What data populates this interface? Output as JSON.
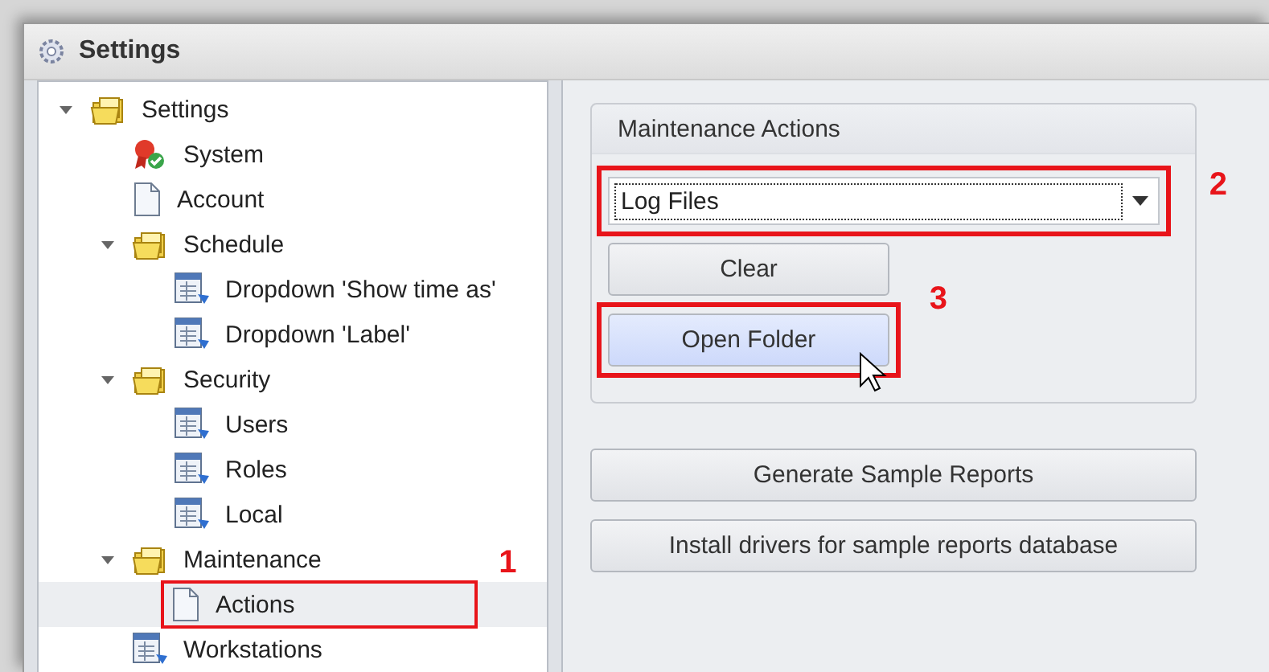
{
  "window": {
    "title": "Settings"
  },
  "tree": [
    {
      "label": "Settings",
      "kind": "folder",
      "expanded": true,
      "selected": false,
      "children": [
        {
          "label": "System",
          "kind": "system",
          "selected": false
        },
        {
          "label": "Account",
          "kind": "page",
          "selected": false
        },
        {
          "label": "Schedule",
          "kind": "folder",
          "expanded": true,
          "selected": false,
          "children": [
            {
              "label": "Dropdown 'Show time as'",
              "kind": "list",
              "selected": false
            },
            {
              "label": "Dropdown 'Label'",
              "kind": "list",
              "selected": false
            }
          ]
        },
        {
          "label": "Security",
          "kind": "folder",
          "expanded": true,
          "selected": false,
          "children": [
            {
              "label": "Users",
              "kind": "list",
              "selected": false
            },
            {
              "label": "Roles",
              "kind": "list",
              "selected": false
            },
            {
              "label": "Local",
              "kind": "list",
              "selected": false
            }
          ]
        },
        {
          "label": "Maintenance",
          "kind": "folder",
          "expanded": true,
          "selected": false,
          "children": [
            {
              "label": "Actions",
              "kind": "page",
              "selected": true,
              "callout": "1"
            }
          ]
        },
        {
          "label": "Workstations",
          "kind": "list",
          "selected": false
        }
      ]
    }
  ],
  "group": {
    "title": "Maintenance Actions",
    "combo": {
      "value": "Log Files",
      "callout": "2"
    },
    "buttons": [
      {
        "label": "Clear",
        "hovered": false
      },
      {
        "label": "Open Folder",
        "hovered": true,
        "callout": "3"
      }
    ]
  },
  "buttons": [
    {
      "label": "Generate Sample Reports"
    },
    {
      "label": "Install drivers for sample reports database"
    }
  ]
}
